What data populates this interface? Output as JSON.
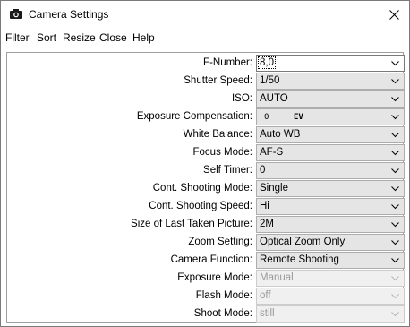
{
  "window": {
    "title": "Camera Settings",
    "icon": "camera-icon",
    "close_icon": "close-icon"
  },
  "menu": [
    "Filter",
    "Sort",
    "Resize",
    "Close",
    "Help"
  ],
  "settings": [
    {
      "label": "F-Number:",
      "value": "8,0",
      "enabled": true
    },
    {
      "label": "Shutter Speed:",
      "value": "1/50",
      "enabled": true
    },
    {
      "label": "ISO:",
      "value": "AUTO",
      "enabled": true
    },
    {
      "label": "Exposure Compensation:",
      "value": "0",
      "unit": "EV",
      "enabled": true
    },
    {
      "label": "White Balance:",
      "value": "Auto WB",
      "enabled": true
    },
    {
      "label": "Focus Mode:",
      "value": "AF-S",
      "enabled": true
    },
    {
      "label": "Self Timer:",
      "value": "0",
      "enabled": true
    },
    {
      "label": "Cont. Shooting Mode:",
      "value": "Single",
      "enabled": true
    },
    {
      "label": "Cont. Shooting Speed:",
      "value": "Hi",
      "enabled": true
    },
    {
      "label": "Size of Last Taken Picture:",
      "value": "2M",
      "enabled": true
    },
    {
      "label": "Zoom Setting:",
      "value": "Optical Zoom Only",
      "enabled": true
    },
    {
      "label": "Camera Function:",
      "value": "Remote Shooting",
      "enabled": true
    },
    {
      "label": "Exposure Mode:",
      "value": "Manual",
      "enabled": false
    },
    {
      "label": "Flash Mode:",
      "value": "off",
      "enabled": false
    },
    {
      "label": "Shoot Mode:",
      "value": "still",
      "enabled": false
    }
  ]
}
